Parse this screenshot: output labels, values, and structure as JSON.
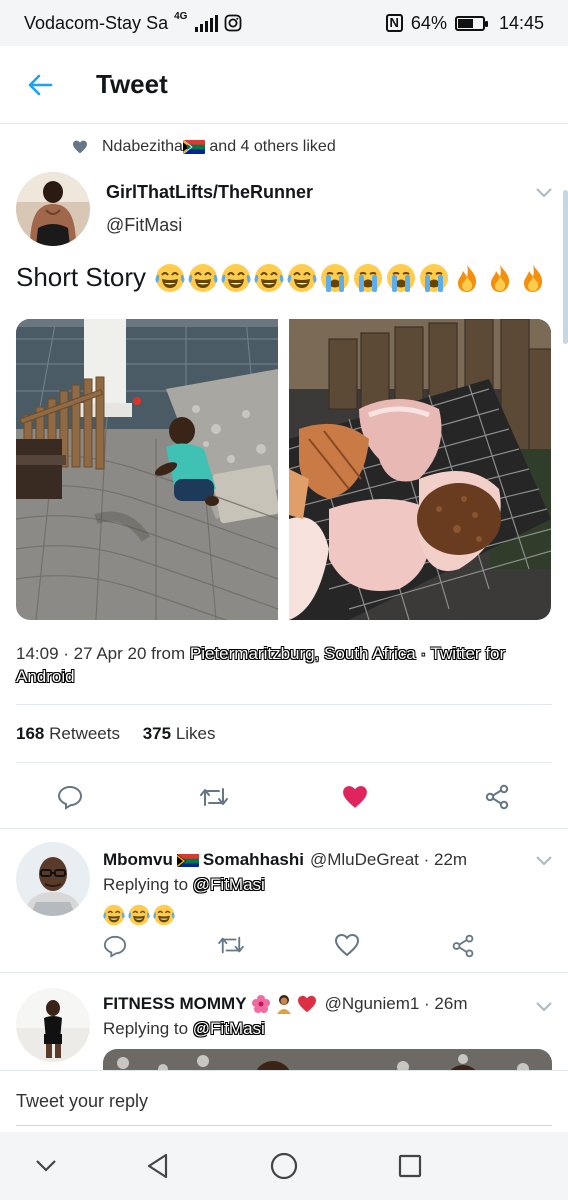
{
  "status_bar": {
    "carrier": "Vodacom-Stay Sa",
    "network": "4G",
    "battery_percent": "64%",
    "battery_level": 0.64,
    "time": "14:45"
  },
  "header": {
    "title": "Tweet"
  },
  "liked_by": {
    "text": "Ndabezitha",
    "others": "and 4 others liked"
  },
  "tweet": {
    "author_name": "GirlThatLifts/TheRunner",
    "author_handle": "@FitMasi",
    "text": "Short Story",
    "emojis": [
      "laughing",
      "laughing",
      "laughing",
      "laughing",
      "laughing",
      "crying",
      "crying",
      "crying",
      "crying",
      "fire",
      "fire",
      "fire"
    ],
    "meta_prefix": "14:09 · 27 Apr 20 from ",
    "meta_location": "Pietermaritzburg, South Africa",
    "meta_sep": " · ",
    "meta_client": "Twitter for Android",
    "retweets_count": "168",
    "retweets_label": "Retweets",
    "likes_count": "375",
    "likes_label": "Likes",
    "liked": true
  },
  "replies": [
    {
      "name": "Mbomvu",
      "name_suffix": "Somahhashi",
      "handle_time": "@MluDeGreat · 22m",
      "replying_prefix": "Replying to ",
      "replying_to": "@FitMasi",
      "emojis": [
        "laughing",
        "laughing",
        "laughing"
      ]
    },
    {
      "name": "FITNESS MOMMY",
      "handle_time": "@Nguniem1 · 26m",
      "replying_prefix": "Replying to ",
      "replying_to": "@FitMasi"
    }
  ],
  "composer": {
    "placeholder": "Tweet your reply"
  },
  "colors": {
    "accent": "#1da1f2",
    "like": "#e0245e",
    "icon": "#657786"
  }
}
